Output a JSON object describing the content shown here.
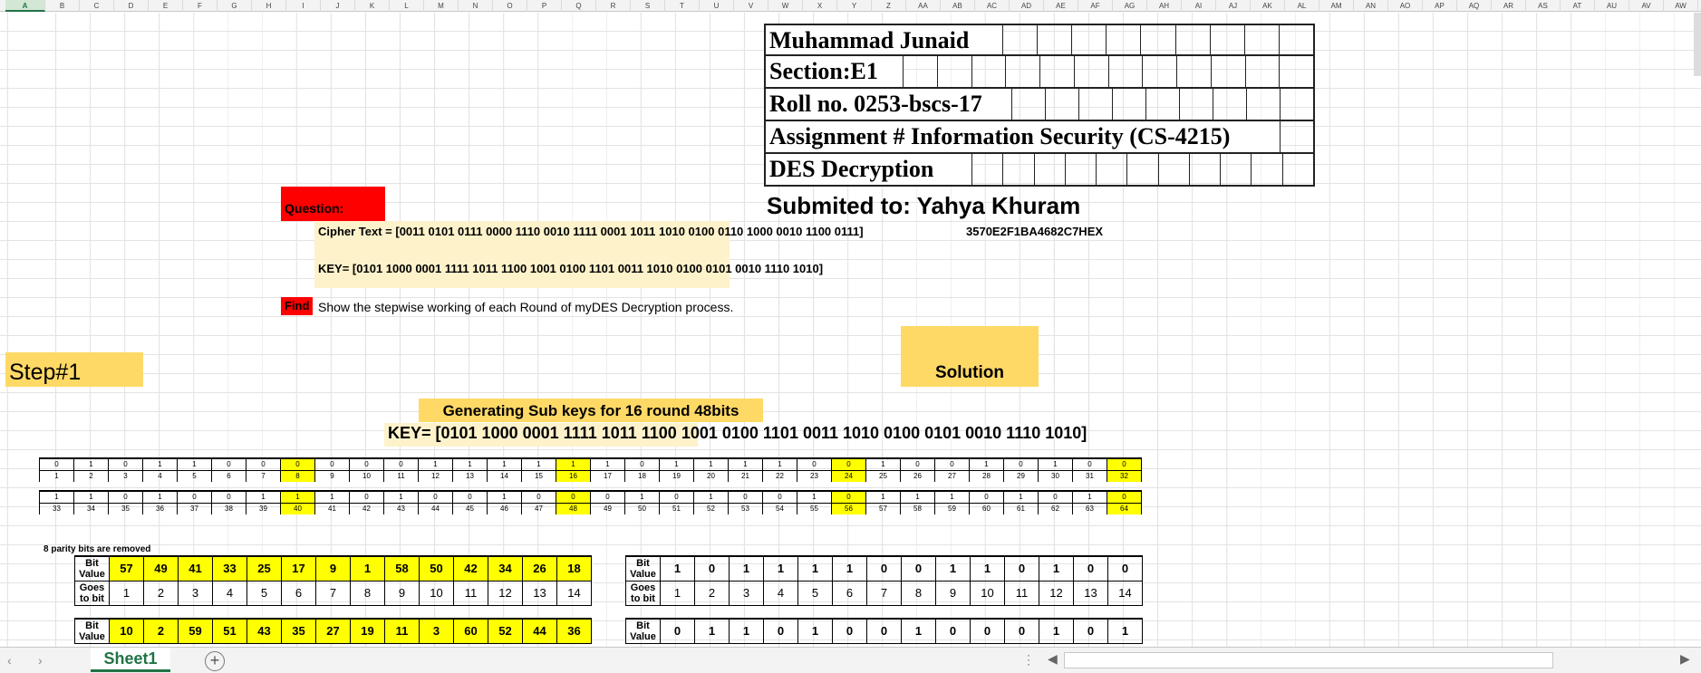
{
  "sheet": {
    "columns": [
      "A",
      "B",
      "C",
      "D",
      "E",
      "F",
      "G",
      "H",
      "I",
      "J",
      "K",
      "L",
      "M",
      "N",
      "O",
      "P",
      "Q",
      "R",
      "S",
      "T",
      "U",
      "V",
      "W",
      "X",
      "Y",
      "Z",
      "AA",
      "AB",
      "AC",
      "AD",
      "AE",
      "AF",
      "AG",
      "AH",
      "AI",
      "AJ",
      "AK",
      "AL",
      "AM",
      "AN",
      "AO",
      "AP",
      "AQ",
      "AR",
      "AS",
      "AT",
      "AU",
      "AV",
      "AW"
    ],
    "active_column": "A",
    "tab_name": "Sheet1",
    "add_sheet_icon": "plus-circle-icon"
  },
  "header": {
    "name": "Muhammad Junaid",
    "section": "Section:E1",
    "roll": "Roll no. 0253-bscs-17",
    "assignment": "Assignment # Information Security (CS-4215)",
    "topic": "DES Decryption",
    "submitted_to": "Submited to: Yahya Khuram"
  },
  "question": {
    "label": "Question:",
    "cipher": "Cipher Text = [0011 0101 0111 0000 1110 0010 1111 0001 1011 1010 0100 0110 1000 0010 1100 0111]",
    "cipher_hex": "3570E2F1BA4682C7HEX",
    "key": "KEY= [0101 1000 0001 1111 1011 1100 1001 0100 1101 0011 1010 0100 0101 0010 1110 1010]",
    "find_label": "Find",
    "find_text": "Show the stepwise working of each Round of myDES Decryption process."
  },
  "step1": {
    "label": "Step#1",
    "solution": "Solution",
    "subkeys_title": "Generating Sub keys for 16  round  48bits",
    "key_line": "KEY= [0101 1000 0001 1111 1011 1100 1001 0100 1101 0011 1010 0100 0101 0010 1110 1010]"
  },
  "bits_row1": {
    "values": [
      "0",
      "1",
      "0",
      "1",
      "1",
      "0",
      "0",
      "0",
      "0",
      "0",
      "0",
      "1",
      "1",
      "1",
      "1",
      "1",
      "1",
      "0",
      "1",
      "1",
      "1",
      "1",
      "0",
      "0",
      "1",
      "0",
      "0",
      "1",
      "0",
      "1",
      "0",
      "0"
    ],
    "positions": [
      "1",
      "2",
      "3",
      "4",
      "5",
      "6",
      "7",
      "8",
      "9",
      "10",
      "11",
      "12",
      "13",
      "14",
      "15",
      "16",
      "17",
      "18",
      "19",
      "20",
      "21",
      "22",
      "23",
      "24",
      "25",
      "26",
      "27",
      "28",
      "29",
      "30",
      "31",
      "32"
    ],
    "highlight": [
      7,
      15,
      23,
      31
    ]
  },
  "bits_row2": {
    "values": [
      "1",
      "1",
      "0",
      "1",
      "0",
      "0",
      "1",
      "1",
      "1",
      "0",
      "1",
      "0",
      "0",
      "1",
      "0",
      "0",
      "0",
      "1",
      "0",
      "1",
      "0",
      "0",
      "1",
      "0",
      "1",
      "1",
      "1",
      "0",
      "1",
      "0",
      "1",
      "0"
    ],
    "positions": [
      "33",
      "34",
      "35",
      "36",
      "37",
      "38",
      "39",
      "40",
      "41",
      "42",
      "43",
      "44",
      "45",
      "46",
      "47",
      "48",
      "49",
      "50",
      "51",
      "52",
      "53",
      "54",
      "55",
      "56",
      "57",
      "58",
      "59",
      "60",
      "61",
      "62",
      "63",
      "64"
    ],
    "highlight": [
      7,
      15,
      23,
      31
    ]
  },
  "parity_note": "8 parity bits are removed",
  "pc1": {
    "label_bit": "Bit Value",
    "label_goes": "Goes to bit",
    "row1_src": [
      "57",
      "49",
      "41",
      "33",
      "25",
      "17",
      "9",
      "1",
      "58",
      "50",
      "42",
      "34",
      "26",
      "18"
    ],
    "row1_goes": [
      "1",
      "2",
      "3",
      "4",
      "5",
      "6",
      "7",
      "8",
      "9",
      "10",
      "11",
      "12",
      "13",
      "14"
    ],
    "row1_bits": [
      "1",
      "0",
      "1",
      "1",
      "1",
      "1",
      "0",
      "0",
      "1",
      "1",
      "0",
      "1",
      "0",
      "0"
    ],
    "row2_src": [
      "10",
      "2",
      "59",
      "51",
      "43",
      "35",
      "27",
      "19",
      "11",
      "3",
      "60",
      "52",
      "44",
      "36"
    ],
    "row2_bits": [
      "0",
      "1",
      "1",
      "0",
      "1",
      "0",
      "0",
      "1",
      "0",
      "0",
      "0",
      "1",
      "0",
      "1"
    ]
  }
}
